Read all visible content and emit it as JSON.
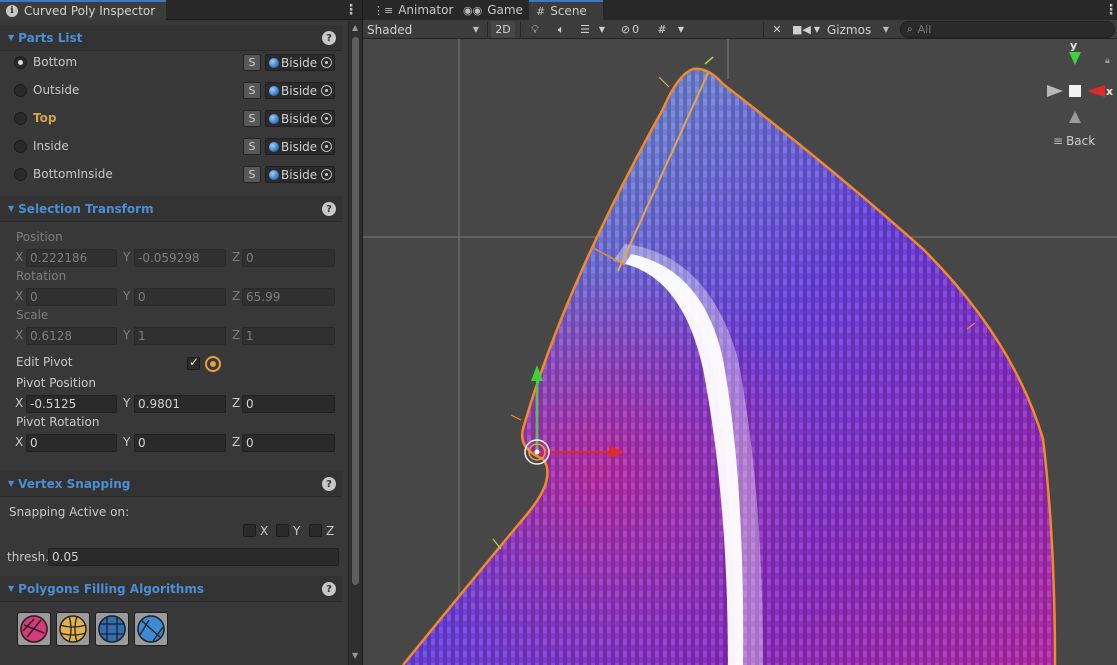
{
  "inspector": {
    "tab_title": "Curved Poly Inspector",
    "parts": {
      "title": "Parts List",
      "s_label": "S",
      "items": [
        {
          "name": "Bottom",
          "side": "Biside",
          "selected": true,
          "highlight": false
        },
        {
          "name": "Outside",
          "side": "Biside",
          "selected": false,
          "highlight": false
        },
        {
          "name": "Top",
          "side": "Biside",
          "selected": false,
          "highlight": true
        },
        {
          "name": "Inside",
          "side": "Biside",
          "selected": false,
          "highlight": false
        },
        {
          "name": "BottomInside",
          "side": "Biside",
          "selected": false,
          "highlight": false
        }
      ]
    },
    "transform": {
      "title": "Selection Transform",
      "position": {
        "label": "Position",
        "x": "0.222186",
        "y": "-0.059298",
        "z": "0"
      },
      "rotation": {
        "label": "Rotation",
        "x": "0",
        "y": "0",
        "z": "65.99"
      },
      "scale": {
        "label": "Scale",
        "x": "0.6128",
        "y": "1",
        "z": "1"
      },
      "edit_pivot": {
        "label": "Edit Pivot",
        "checked": true
      },
      "pivot_position": {
        "label": "Pivot Position",
        "x": "-0.5125",
        "y": "0.9801",
        "z": "0"
      },
      "pivot_rotation": {
        "label": "Pivot Rotation",
        "x": "0",
        "y": "0",
        "z": "0"
      },
      "axis_x": "X",
      "axis_y": "Y",
      "axis_z": "Z"
    },
    "snapping": {
      "title": "Vertex Snapping",
      "active_label": "Snapping Active on:",
      "x_label": "X",
      "y_label": "Y",
      "z_label": "Z",
      "thresh_label": "thresh.",
      "thresh_value": "0.05"
    },
    "algorithms": {
      "title": "Polygons Filling Algorithms",
      "icons": [
        "algorithm-pink-icon",
        "algorithm-yellow-icon",
        "algorithm-blue-icon",
        "algorithm-lightblue-icon"
      ]
    },
    "help_label": "?"
  },
  "scene": {
    "tabs": [
      {
        "label": "Animator",
        "icon": "animator-icon"
      },
      {
        "label": "Game",
        "icon": "game-icon"
      },
      {
        "label": "Scene",
        "icon": "scene-icon"
      }
    ],
    "shading_mode": "Shaded",
    "mode_2d": "2D",
    "hidden_count": "0",
    "gizmos_label": "Gizmos",
    "search_placeholder": "All",
    "orientation": {
      "y": "y",
      "x": "x",
      "back_label": "Back"
    }
  },
  "colors": {
    "accent_blue": "#4b8ed6",
    "highlight_orange": "#d7a24c",
    "outline_orange": "#f08a2a",
    "handle_green": "#3bd33b",
    "handle_red": "#e02a2a"
  }
}
